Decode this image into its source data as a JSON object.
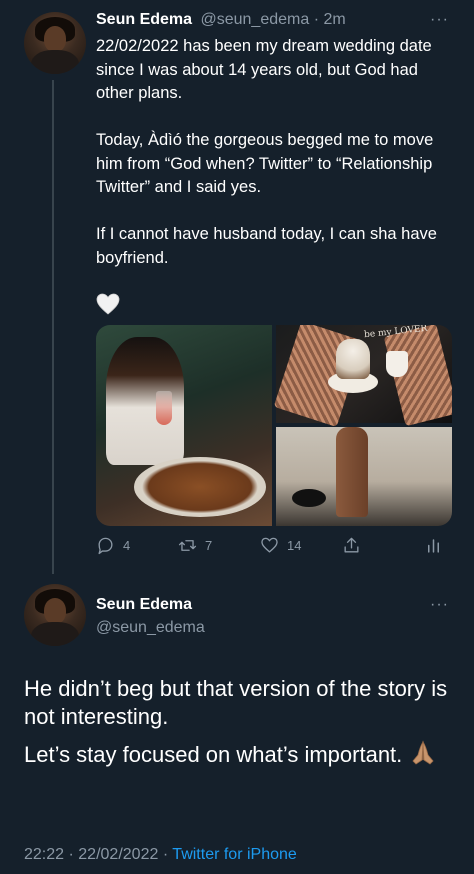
{
  "colors": {
    "background": "#15202b",
    "text": "#ffffff",
    "muted": "#8b98a5",
    "link": "#1d9bf0",
    "divider": "#38444d"
  },
  "tweet1": {
    "author_name": "Seun Edema",
    "author_handle": "@seun_edema",
    "separator": "·",
    "time": "2m",
    "more_label": "···",
    "paragraphs": [
      "22/02/2022 has been my dream wedding date since I was about 14 years old, but God had other plans.",
      "Today, Àdìó the gorgeous begged me to move him from “God when? Twitter” to “Relationship Twitter” and I said yes.",
      "If I cannot have husband today, I can sha have boyfriend."
    ],
    "heart_icon": "white-heart-emoji",
    "media": {
      "photos": 3,
      "plate_text": "be my LOVER"
    },
    "actions": {
      "replies": "4",
      "retweets": "7",
      "likes": "14"
    }
  },
  "tweet2": {
    "author_name": "Seun Edema",
    "author_handle": "@seun_edema",
    "more_label": "···",
    "paragraphs": [
      "He didn’t beg but that version of the story is not interesting.",
      "Let’s stay focused on what’s important."
    ],
    "emoji": "folded-hands-emoji",
    "time": "22:22",
    "separator": "·",
    "date": "22/02/2022",
    "separator2": "·",
    "source": "Twitter for iPhone"
  }
}
